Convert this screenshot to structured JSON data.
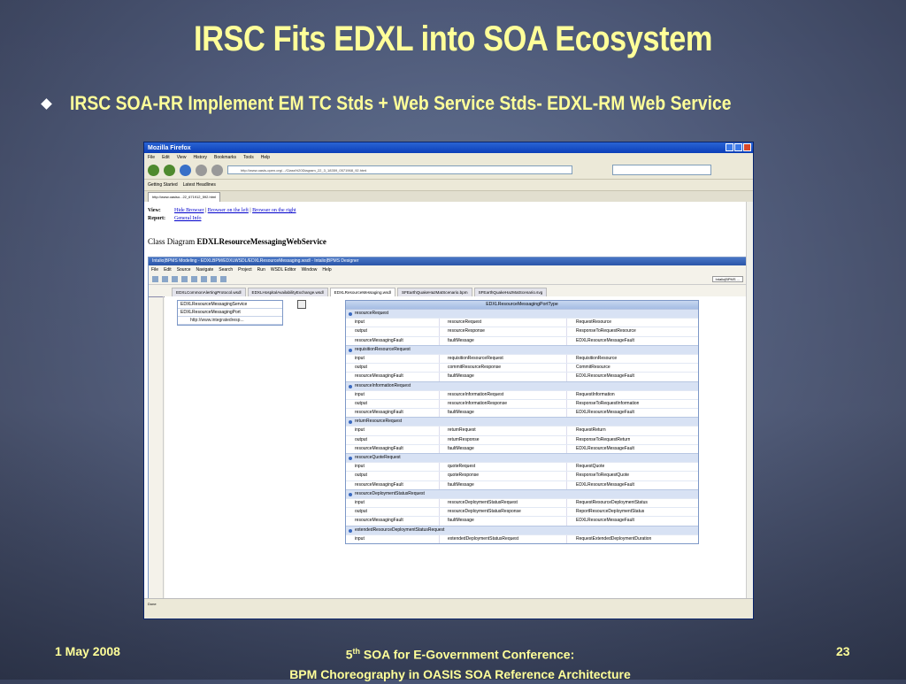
{
  "slide": {
    "title": "IRSC Fits EDXL into SOA Ecosystem",
    "bullet": "IRSC SOA-RR Implement EM TC Stds + Web Service Stds- EDXL-RM Web Service",
    "footer_date": "1 May 2008",
    "footer_line1_num": "5",
    "footer_line1_sup": "th",
    "footer_line1_rest": " SOA for E-Government Conference:",
    "footer_line2": "BPM Choreography in OASIS SOA Reference Architecture",
    "page_number": "23"
  },
  "browser": {
    "title": "Mozilla Firefox",
    "menu": [
      "File",
      "Edit",
      "View",
      "History",
      "Bookmarks",
      "Tools",
      "Help"
    ],
    "url": "http://www.oasis-open.org/.../Class%20Diagram_22_3_18359_0571968_92.html",
    "bookmarks": [
      "Getting Started",
      "Latest Headlines"
    ],
    "tab": "http://www.oasiso...22_671912_592.html",
    "view_label": "View:",
    "view_links": [
      "Hide Browser",
      "Browser on the left",
      "Browser on the right"
    ],
    "report_label": "Report:",
    "report_link": "General Info",
    "class_diagram_prefix": "Class Diagram ",
    "class_diagram_name": "EDXLResourceMessagingWebService",
    "status": "Done"
  },
  "eclipse": {
    "title": "Intalio|BPMS Modeling - EDXLBPM/EDXLWSDL/EDXLResourceMessaging.wsdl - Intalio|BPMS Designer",
    "menu": [
      "File",
      "Edit",
      "Source",
      "Navigate",
      "Search",
      "Project",
      "Run",
      "WSDL Editor",
      "Window",
      "Help"
    ],
    "perspective": "Intalio|BPMS ...",
    "tabs": [
      "EDXLCommonAlertingProtocol.wsdl",
      "EDXLHospitalAvailabilityExchange.wsdl",
      "EDXLResourceMessaging.wsdl",
      "SFEarthQuakeHazMatScenario.bpm",
      "SFEarthQuakeHazMatScenario.svg"
    ],
    "service": {
      "name": "EDXLResourceMessagingService",
      "port": "EDXLResourceMessagingPort",
      "address": "http://www.integratedresp..."
    },
    "port_type": "EDXLResourceMessagingPortType",
    "operations": [
      {
        "name": "resourceRequest",
        "rows": [
          [
            "input",
            "resourceRequest",
            "RequestResource"
          ],
          [
            "output",
            "resourceResponse",
            "ResponseToRequestResource"
          ],
          [
            "resourceMessagingFault",
            "faultMessage",
            "EDXLResourceMessageFault"
          ]
        ]
      },
      {
        "name": "requisitionResourceRequest",
        "rows": [
          [
            "input",
            "requisitionResourceRequest",
            "RequisitionResource"
          ],
          [
            "output",
            "commitResourceResponse",
            "CommitResource"
          ],
          [
            "resourceMessagingFault",
            "faultMessage",
            "EDXLResourceMessageFault"
          ]
        ]
      },
      {
        "name": "resourceInformationRequest",
        "rows": [
          [
            "input",
            "resourceInformationRequest",
            "RequestInformation"
          ],
          [
            "output",
            "resourceInformationResponse",
            "ResponseToRequestInformation"
          ],
          [
            "resourceMessagingFault",
            "faultMessage",
            "EDXLResourceMessageFault"
          ]
        ]
      },
      {
        "name": "returnResourceRequest",
        "rows": [
          [
            "input",
            "returnRequest",
            "RequestReturn"
          ],
          [
            "output",
            "returnResponse",
            "ResponseToRequestReturn"
          ],
          [
            "resourceMessagingFault",
            "faultMessage",
            "EDXLResourceMessageFault"
          ]
        ]
      },
      {
        "name": "resourceQuoteRequest",
        "rows": [
          [
            "input",
            "quoteRequest",
            "RequestQuote"
          ],
          [
            "output",
            "quoteResponse",
            "ResponseToRequestQuote"
          ],
          [
            "resourceMessagingFault",
            "faultMessage",
            "EDXLResourceMessageFault"
          ]
        ]
      },
      {
        "name": "resourceDeploymentStatusRequest",
        "rows": [
          [
            "input",
            "resourceDeploymentStatusRequest",
            "RequestResourceDeploymentStatus"
          ],
          [
            "output",
            "resourceDeploymentStatusResponse",
            "ReportResourceDeploymentStatus"
          ],
          [
            "resourceMessagingFault",
            "faultMessage",
            "EDXLResourceMessageFault"
          ]
        ]
      },
      {
        "name": "extendedResourceDeploymentStatusRequest",
        "rows": [
          [
            "input",
            "extendedDeploymentStatusRequest",
            "RequestExtendedDeploymentDuration"
          ]
        ]
      }
    ]
  }
}
